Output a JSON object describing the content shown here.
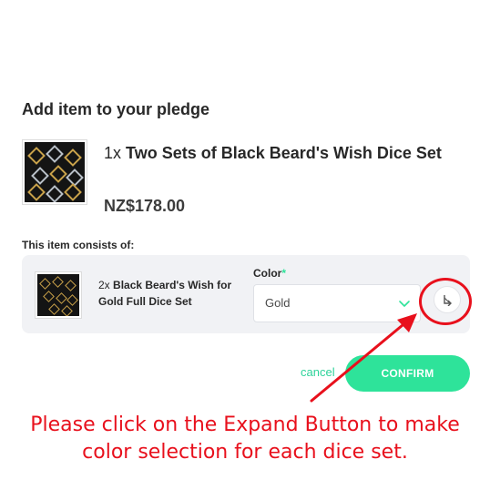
{
  "modal": {
    "title": "Add item to your pledge"
  },
  "product": {
    "quantity": "1x",
    "name": "Two Sets of Black Beard's Wish Dice Set",
    "price": "NZ$178.00"
  },
  "consists": {
    "label": "This item consists of:",
    "item": {
      "quantity": "2x",
      "name": "Black Beard's Wish for Gold Full Dice Set",
      "color_label": "Color",
      "required_mark": "*",
      "color_value": "Gold"
    }
  },
  "actions": {
    "cancel_label": "cancel",
    "confirm_label": "CONFIRM"
  },
  "annotation": {
    "instruction": "Please click on the Expand Button to make color selection for each dice set."
  },
  "colors": {
    "accent": "#2ee39a",
    "annotation_red": "#e8101c",
    "panel_bg": "#f1f2f5"
  },
  "icons": {
    "chevron": "chevron-down-icon",
    "expand": "expand-icon"
  }
}
